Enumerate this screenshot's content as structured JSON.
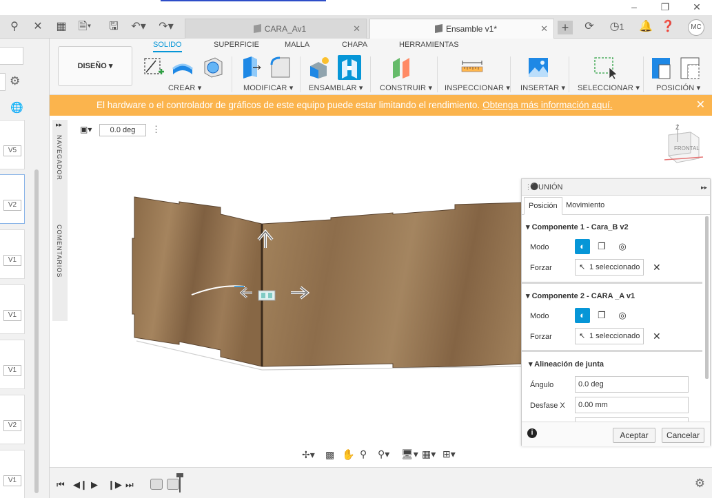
{
  "tabs": [
    {
      "label": "CARA_Av1",
      "active": false
    },
    {
      "label": "Ensamble v1*",
      "active": true
    }
  ],
  "header": {
    "job_count": "1",
    "user_initials": "MC"
  },
  "toolbar": {
    "workspace": "DISEÑO",
    "workspace_tabs": [
      "SOLIDO",
      "SUPERFICIE",
      "MALLA",
      "CHAPA",
      "HERRAMIENTAS"
    ],
    "groups": [
      "CREAR",
      "MODIFICAR",
      "ENSAMBLAR",
      "CONSTRUIR",
      "INSPECCIONAR",
      "INSERTAR",
      "SELECCIONAR",
      "POSICIÓN"
    ]
  },
  "banner": {
    "message": "El hardware o el controlador de gráficos de este equipo puede estar limitando el rendimiento.",
    "link": "Obtenga más información aquí."
  },
  "browser": {
    "versions": [
      "V5",
      "V2",
      "V1",
      "V1",
      "V1",
      "V2",
      "V1"
    ]
  },
  "canvas": {
    "angle": "0.0 deg",
    "navigator_label": "NAVEGADOR",
    "comments_label": "COMENTARIOS",
    "viewcube_label": "FRONTAL",
    "viewcube_axis": "Z"
  },
  "panel": {
    "title": "UNIÓN",
    "tabs": [
      "Posición",
      "Movimiento"
    ],
    "component1": {
      "heading": "Componente 1 - Cara_B v2",
      "mode_label": "Modo",
      "force_label": "Forzar",
      "selection": "1 seleccionado"
    },
    "component2": {
      "heading": "Componente 2 - CARA _A v1",
      "mode_label": "Modo",
      "force_label": "Forzar",
      "selection": "1 seleccionado"
    },
    "alignment": {
      "heading": "Alineación de junta",
      "angle_label": "Ángulo",
      "angle_value": "0.0 deg",
      "offset_label": "Desfase X",
      "offset_value": "0.00 mm"
    },
    "ok": "Aceptar",
    "cancel": "Cancelar"
  },
  "colors": {
    "accent": "#0696d7",
    "banner": "#fbb44d",
    "wood": "#9a7b58"
  }
}
